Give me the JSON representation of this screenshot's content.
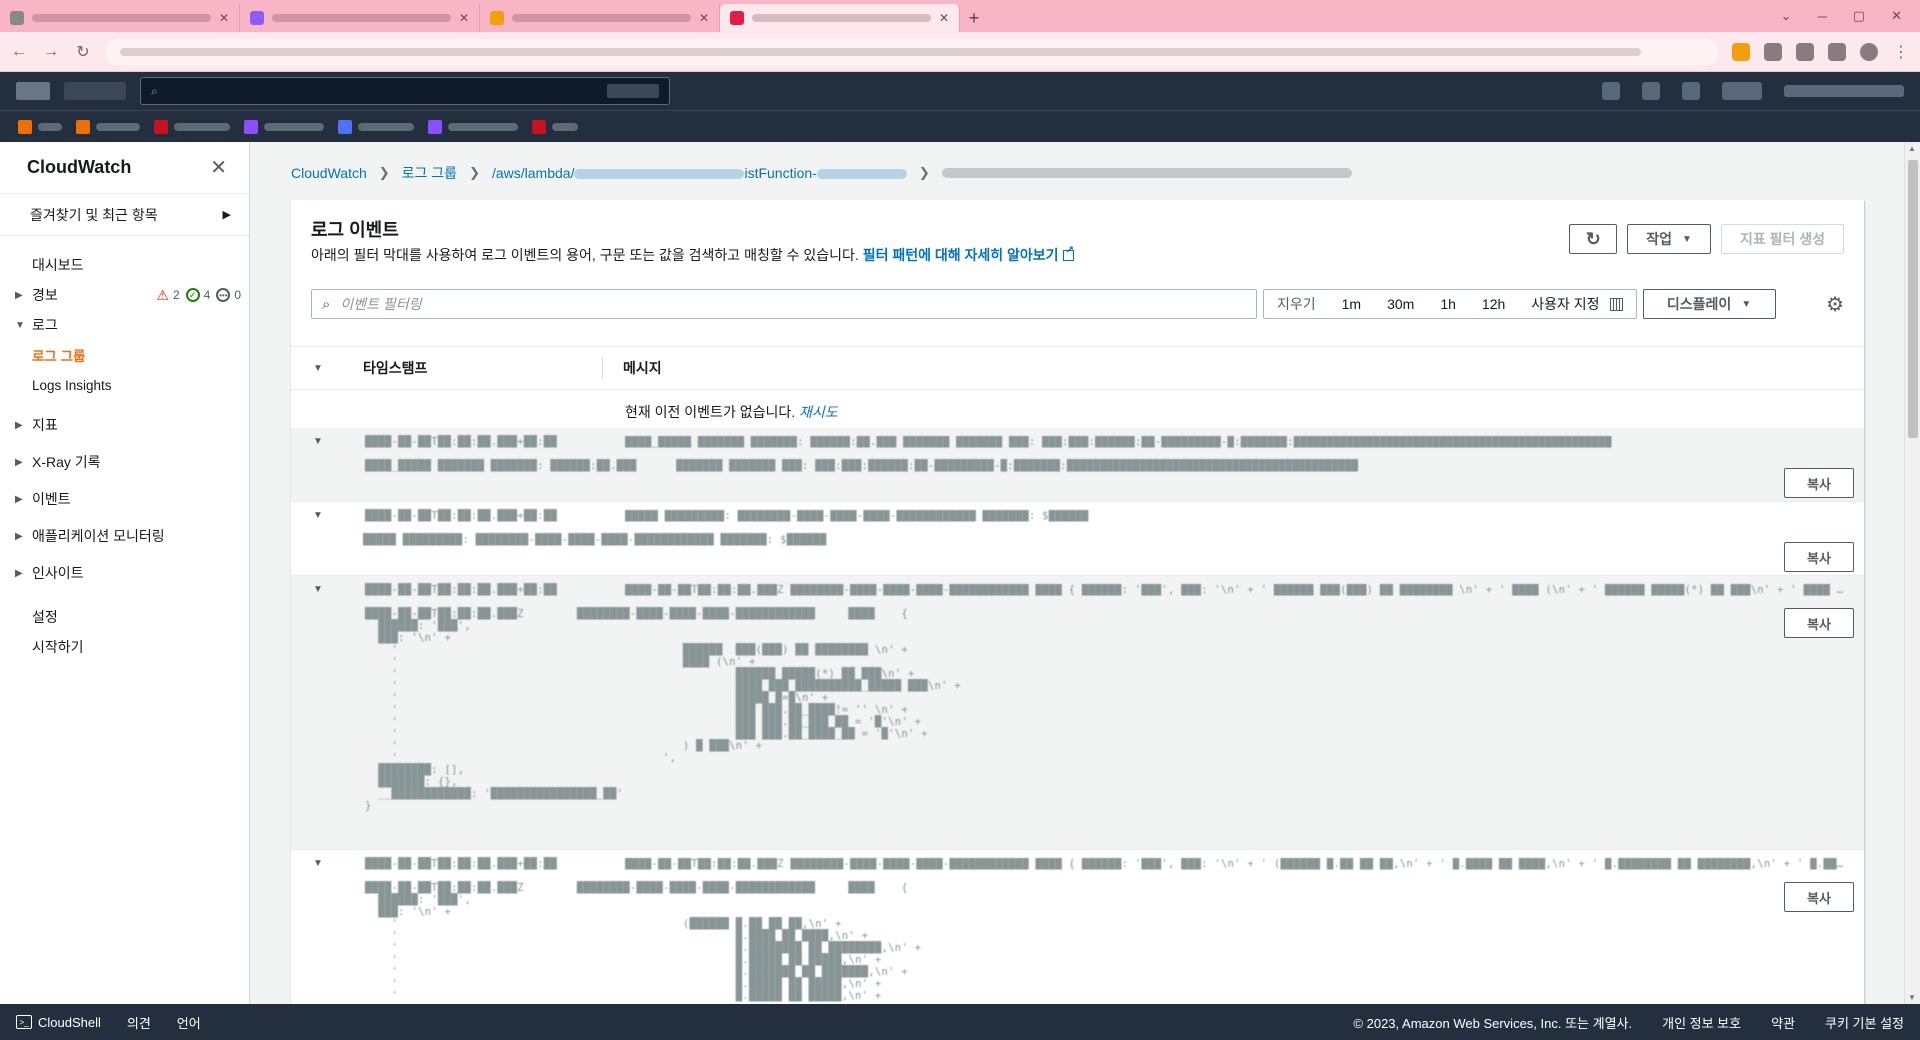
{
  "sidenav": {
    "title": "CloudWatch",
    "favorites_label": "즐겨찾기 및 최근 항목",
    "dashboard": "대시보드",
    "alarms": {
      "label": "경보",
      "in_alarm": "2",
      "ok": "4",
      "insufficient": "0"
    },
    "logs": "로그",
    "log_groups": "로그 그룹",
    "logs_insights": "Logs Insights",
    "metrics": "지표",
    "xray": "X-Ray 기록",
    "events": "이벤트",
    "app_monitoring": "애플리케이션 모니터링",
    "insights": "인사이트",
    "settings": "설정",
    "getting_started": "시작하기"
  },
  "breadcrumb": {
    "root": "CloudWatch",
    "log_groups": "로그 그룹",
    "group_prefix": "/aws/lambda/",
    "group_suffix": "istFunction-"
  },
  "panel": {
    "title": "로그 이벤트",
    "description": "아래의 필터 막대를 사용하여 로그 이벤트의 용어, 구문 또는 값을 검색하고 매칭할 수 있습니다.",
    "learn_more": "필터 패턴에 대해 자세히 알아보기",
    "actions_button": "작업",
    "create_metric_filter": "지표 필터 생성"
  },
  "filter": {
    "placeholder": "이벤트 필터링",
    "clear": "지우기",
    "ranges": [
      "1m",
      "30m",
      "1h",
      "12h"
    ],
    "custom": "사용자 지정",
    "display": "디스플레이"
  },
  "table": {
    "col_timestamp": "타임스탬프",
    "col_message": "메시지",
    "no_prev": "현재 이전 이벤트가 없습니다.",
    "retry": "재시도",
    "copy_label": "복사"
  },
  "footer": {
    "cloudshell": "CloudShell",
    "feedback": "의견",
    "language": "언어",
    "copyright": "© 2023, Amazon Web Services, Inc. 또는 계열사.",
    "privacy": "개인 정보 보호",
    "terms": "약관",
    "cookies": "쿠키 기본 설정"
  }
}
